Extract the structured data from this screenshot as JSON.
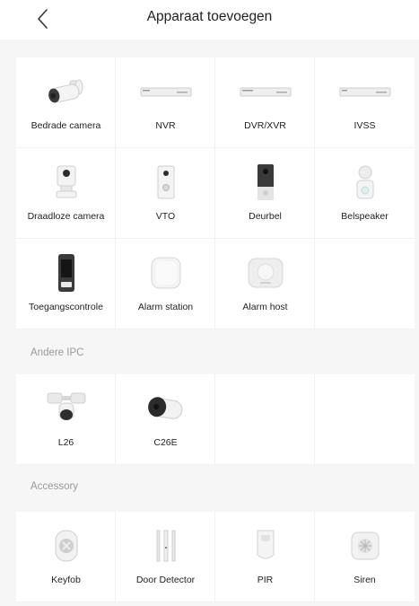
{
  "header": {
    "title": "Apparaat toevoegen",
    "back_icon": "chevron-left-icon"
  },
  "main_devices": [
    {
      "label": "Bedrade camera",
      "icon": "bullet-camera-icon"
    },
    {
      "label": "NVR",
      "icon": "nvr-recorder-icon"
    },
    {
      "label": "DVR/XVR",
      "icon": "dvr-recorder-icon"
    },
    {
      "label": "IVSS",
      "icon": "ivss-recorder-icon"
    },
    {
      "label": "Draadloze camera",
      "icon": "wireless-camera-icon"
    },
    {
      "label": "VTO",
      "icon": "vto-intercom-icon"
    },
    {
      "label": "Deurbel",
      "icon": "doorbell-icon"
    },
    {
      "label": "Belspeaker",
      "icon": "chime-speaker-icon"
    },
    {
      "label": "Toegangscontrole",
      "icon": "access-control-icon"
    },
    {
      "label": "Alarm station",
      "icon": "alarm-station-icon"
    },
    {
      "label": "Alarm host",
      "icon": "alarm-host-icon"
    }
  ],
  "section_ipc": {
    "title": "Andere IPC",
    "items": [
      {
        "label": "L26",
        "icon": "floodlight-camera-icon"
      },
      {
        "label": "C26E",
        "icon": "mini-bullet-camera-icon"
      }
    ]
  },
  "section_accessory": {
    "title": "Accessory",
    "items": [
      {
        "label": "Keyfob",
        "icon": "keyfob-icon"
      },
      {
        "label": "Door Detector",
        "icon": "door-detector-icon"
      },
      {
        "label": "PIR",
        "icon": "pir-sensor-icon"
      },
      {
        "label": "Siren",
        "icon": "siren-icon"
      }
    ]
  }
}
